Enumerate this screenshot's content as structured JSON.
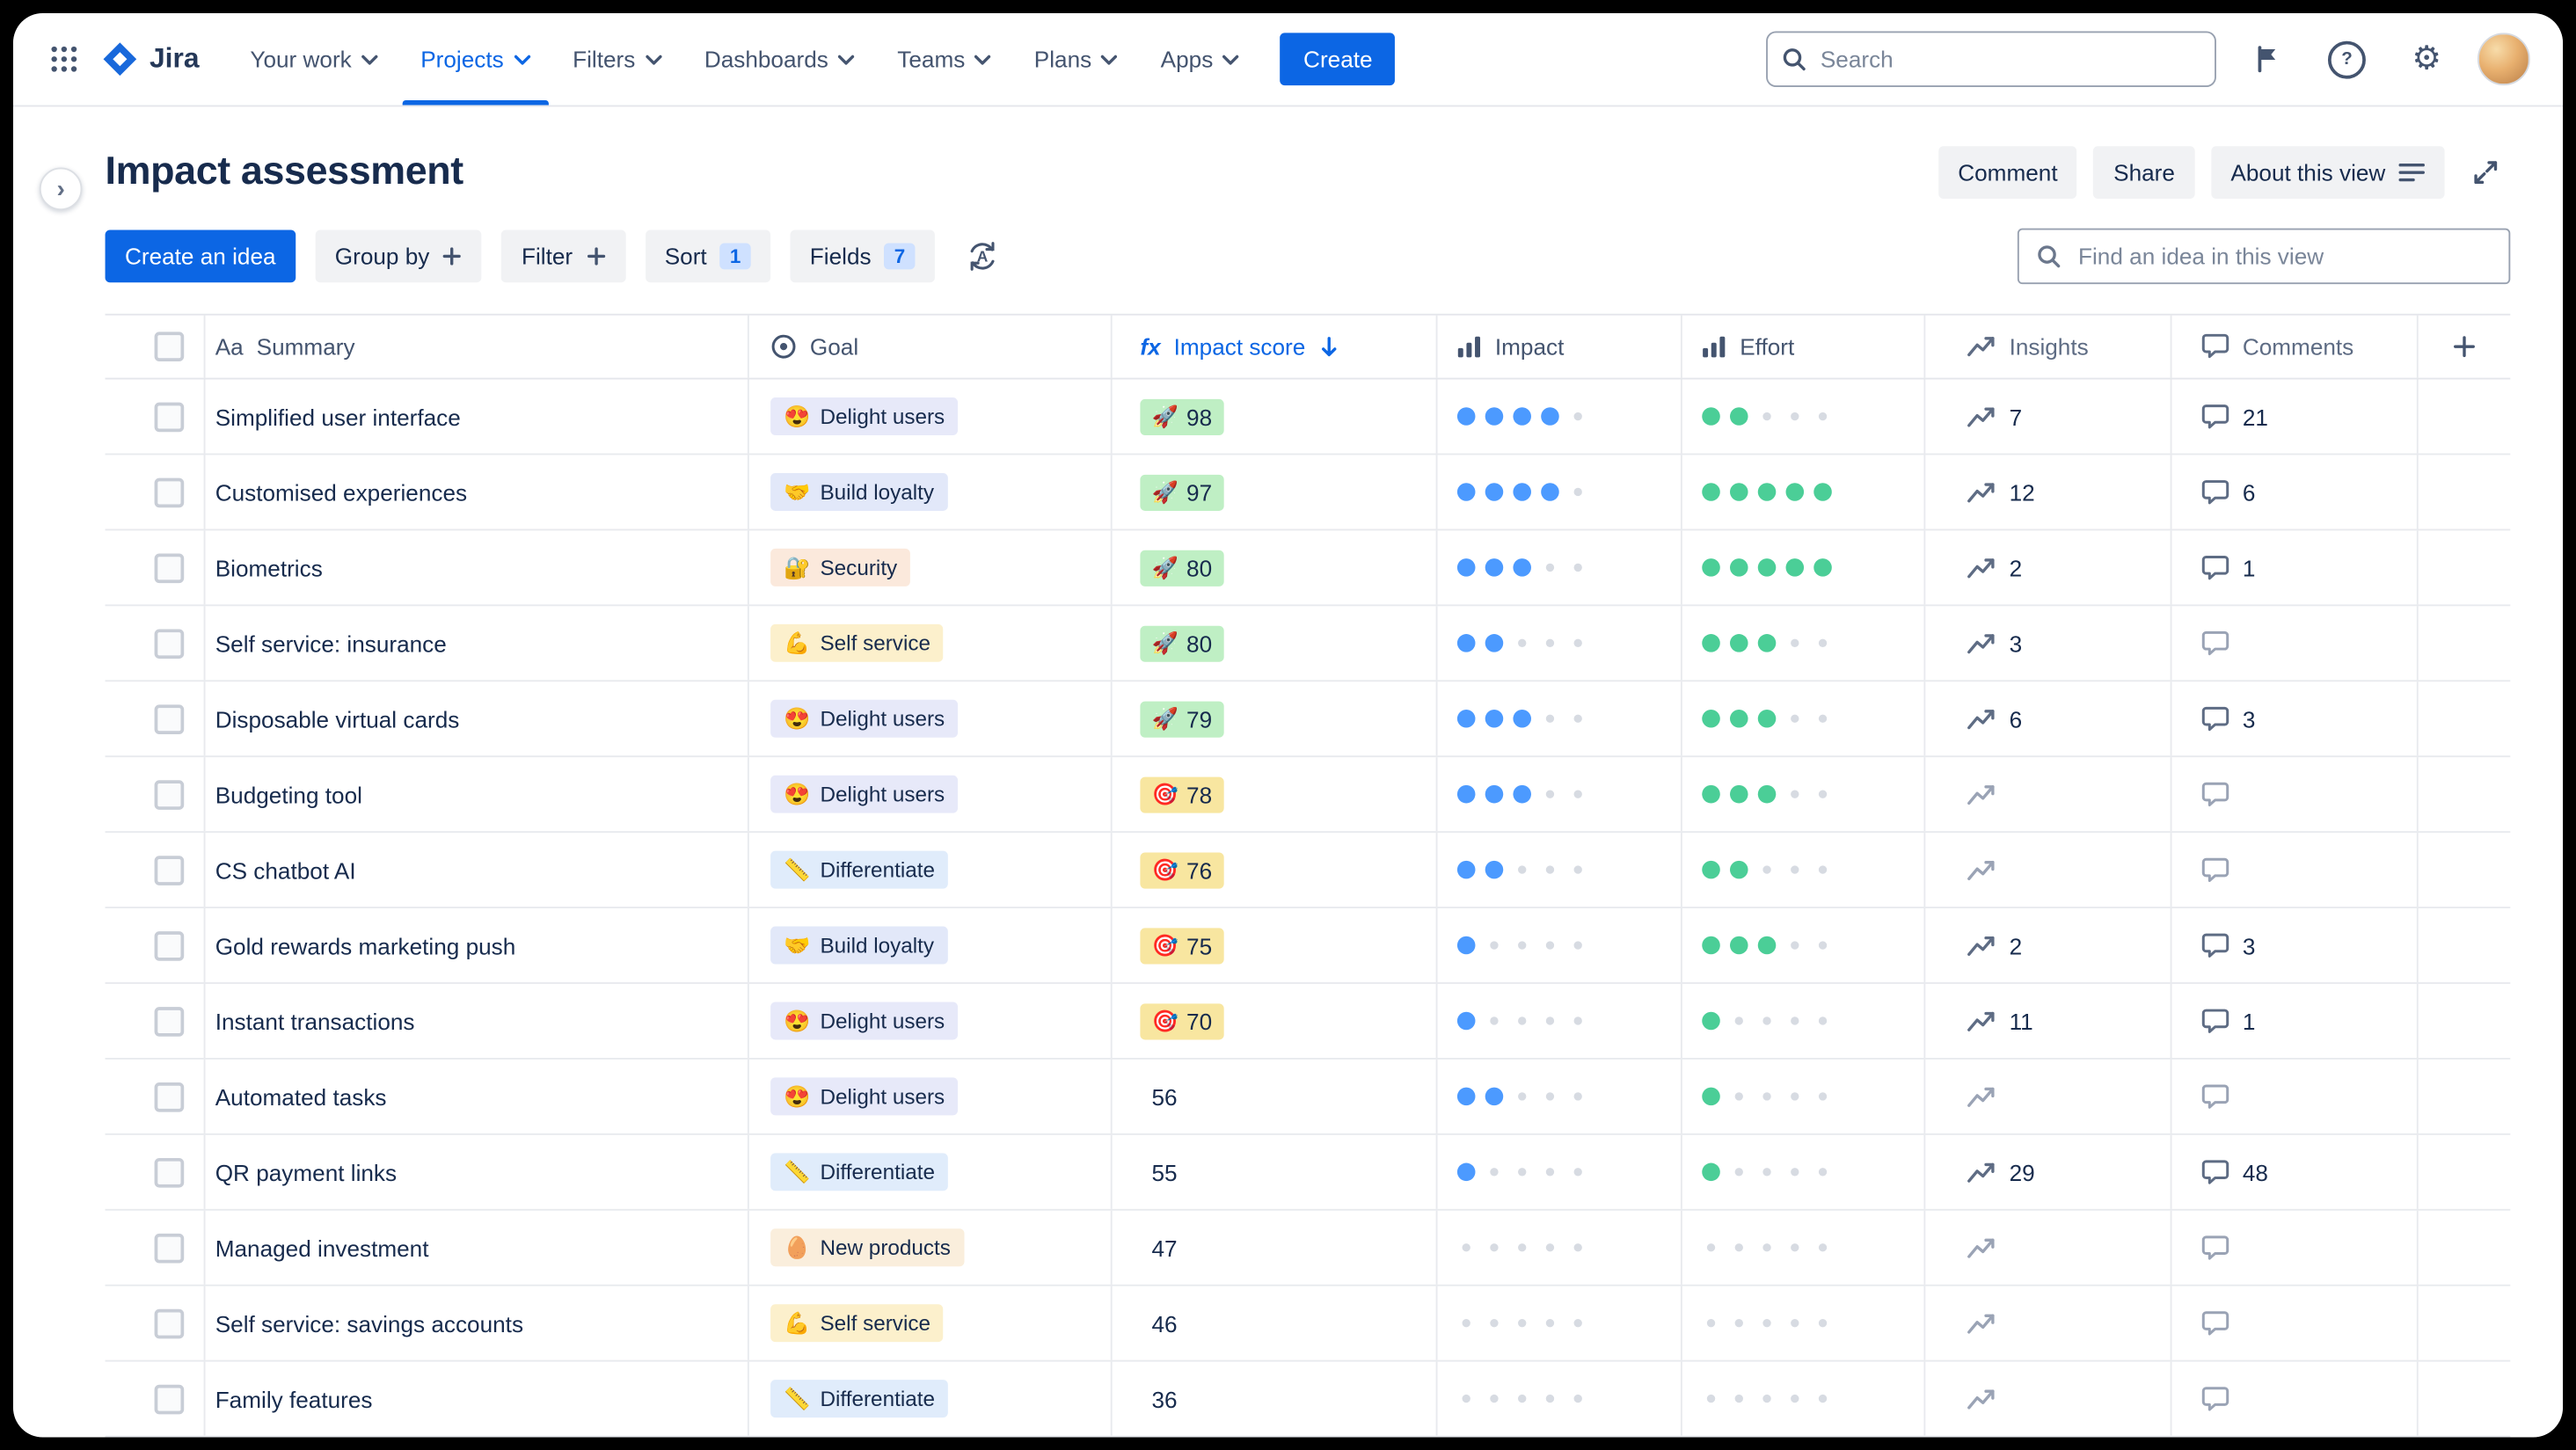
{
  "nav": {
    "logo_text": "Jira",
    "items": [
      {
        "label": "Your work"
      },
      {
        "label": "Projects"
      },
      {
        "label": "Filters"
      },
      {
        "label": "Dashboards"
      },
      {
        "label": "Teams"
      },
      {
        "label": "Plans"
      },
      {
        "label": "Apps"
      }
    ],
    "active_item": "Projects",
    "create_label": "Create",
    "search_placeholder": "Search"
  },
  "header": {
    "title": "Impact assessment",
    "actions": [
      "Comment",
      "Share",
      "About this view"
    ]
  },
  "toolbar": {
    "create_idea": "Create an idea",
    "group_by": "Group by",
    "filter": "Filter",
    "sort": "Sort",
    "sort_count": "1",
    "fields": "Fields",
    "fields_count": "7",
    "find_placeholder": "Find an idea in this view"
  },
  "icons": {
    "aa": "Aa",
    "fx": "fx",
    "help": "?",
    "settings": "⚙",
    "chevron": "›"
  },
  "colors": {
    "accent_blue": "#0C66E4",
    "impact_dot": "#4C9AFF",
    "effort_dot": "#4BCE97",
    "score_green": "#BFEFC4",
    "score_yellow": "#F8E6A0"
  },
  "table": {
    "columns": [
      {
        "id": "summary",
        "label": "Summary",
        "icon": "text-field-icon"
      },
      {
        "id": "goal",
        "label": "Goal",
        "icon": "goal-icon"
      },
      {
        "id": "score",
        "label": "Impact score",
        "icon": "formula-icon",
        "sorted": "desc"
      },
      {
        "id": "impact",
        "label": "Impact",
        "icon": "bar-chart-icon"
      },
      {
        "id": "effort",
        "label": "Effort",
        "icon": "bar-chart-icon"
      },
      {
        "id": "insights",
        "label": "Insights",
        "icon": "trend-icon"
      },
      {
        "id": "comments",
        "label": "Comments",
        "icon": "comment-icon"
      }
    ],
    "rows": [
      {
        "summary": "Simplified user interface",
        "goal": {
          "emoji": "😍",
          "label": "Delight users",
          "bg": "#E7E9F9"
        },
        "score": {
          "value": "98",
          "emoji": "🚀",
          "bg": "#BFEFC4"
        },
        "impact": 4,
        "effort": 2,
        "insights": "7",
        "comments": "21"
      },
      {
        "summary": "Customised experiences",
        "goal": {
          "emoji": "🤝",
          "label": "Build loyalty",
          "bg": "#E2E8F9"
        },
        "score": {
          "value": "97",
          "emoji": "🚀",
          "bg": "#BFEFC4"
        },
        "impact": 4,
        "effort": 5,
        "insights": "12",
        "comments": "6"
      },
      {
        "summary": "Biometrics",
        "goal": {
          "emoji": "🔐",
          "label": "Security",
          "bg": "#FBE9DC"
        },
        "score": {
          "value": "80",
          "emoji": "🚀",
          "bg": "#BFEFC4"
        },
        "impact": 3,
        "effort": 5,
        "insights": "2",
        "comments": "1"
      },
      {
        "summary": "Self service: insurance",
        "goal": {
          "emoji": "💪",
          "label": "Self service",
          "bg": "#FCF0CC"
        },
        "score": {
          "value": "80",
          "emoji": "🚀",
          "bg": "#BFEFC4"
        },
        "impact": 2,
        "effort": 3,
        "insights": "3",
        "comments": ""
      },
      {
        "summary": "Disposable virtual cards",
        "goal": {
          "emoji": "😍",
          "label": "Delight users",
          "bg": "#E7E9F9"
        },
        "score": {
          "value": "79",
          "emoji": "🚀",
          "bg": "#BFEFC4"
        },
        "impact": 3,
        "effort": 3,
        "insights": "6",
        "comments": "3"
      },
      {
        "summary": "Budgeting tool",
        "goal": {
          "emoji": "😍",
          "label": "Delight users",
          "bg": "#E7E9F9"
        },
        "score": {
          "value": "78",
          "emoji": "🎯",
          "bg": "#F8E6A0"
        },
        "impact": 3,
        "effort": 3,
        "insights": "",
        "comments": ""
      },
      {
        "summary": "CS chatbot AI",
        "goal": {
          "emoji": "📏",
          "label": "Differentiate",
          "bg": "#E0ECFB"
        },
        "score": {
          "value": "76",
          "emoji": "🎯",
          "bg": "#F8E6A0"
        },
        "impact": 2,
        "effort": 2,
        "insights": "",
        "comments": ""
      },
      {
        "summary": "Gold rewards marketing push",
        "goal": {
          "emoji": "🤝",
          "label": "Build loyalty",
          "bg": "#E2E8F9"
        },
        "score": {
          "value": "75",
          "emoji": "🎯",
          "bg": "#F8E6A0"
        },
        "impact": 1,
        "effort": 3,
        "insights": "2",
        "comments": "3"
      },
      {
        "summary": "Instant transactions",
        "goal": {
          "emoji": "😍",
          "label": "Delight users",
          "bg": "#E7E9F9"
        },
        "score": {
          "value": "70",
          "emoji": "🎯",
          "bg": "#F8E6A0"
        },
        "impact": 1,
        "effort": 1,
        "insights": "11",
        "comments": "1"
      },
      {
        "summary": "Automated tasks",
        "goal": {
          "emoji": "😍",
          "label": "Delight users",
          "bg": "#E7E9F9"
        },
        "score": {
          "value": "56",
          "emoji": "",
          "bg": ""
        },
        "impact": 2,
        "effort": 1,
        "insights": "",
        "comments": ""
      },
      {
        "summary": "QR payment links",
        "goal": {
          "emoji": "📏",
          "label": "Differentiate",
          "bg": "#E0ECFB"
        },
        "score": {
          "value": "55",
          "emoji": "",
          "bg": ""
        },
        "impact": 1,
        "effort": 1,
        "insights": "29",
        "comments": "48"
      },
      {
        "summary": "Managed investment",
        "goal": {
          "emoji": "🥚",
          "label": "New products",
          "bg": "#FAEEDC"
        },
        "score": {
          "value": "47",
          "emoji": "",
          "bg": ""
        },
        "impact": 0,
        "effort": 0,
        "insights": "",
        "comments": ""
      },
      {
        "summary": "Self service: savings accounts",
        "goal": {
          "emoji": "💪",
          "label": "Self service",
          "bg": "#FCF0CC"
        },
        "score": {
          "value": "46",
          "emoji": "",
          "bg": ""
        },
        "impact": 0,
        "effort": 0,
        "insights": "",
        "comments": ""
      },
      {
        "summary": "Family features",
        "goal": {
          "emoji": "📏",
          "label": "Differentiate",
          "bg": "#E0ECFB"
        },
        "score": {
          "value": "36",
          "emoji": "",
          "bg": ""
        },
        "impact": 0,
        "effort": 0,
        "insights": "",
        "comments": ""
      }
    ]
  }
}
